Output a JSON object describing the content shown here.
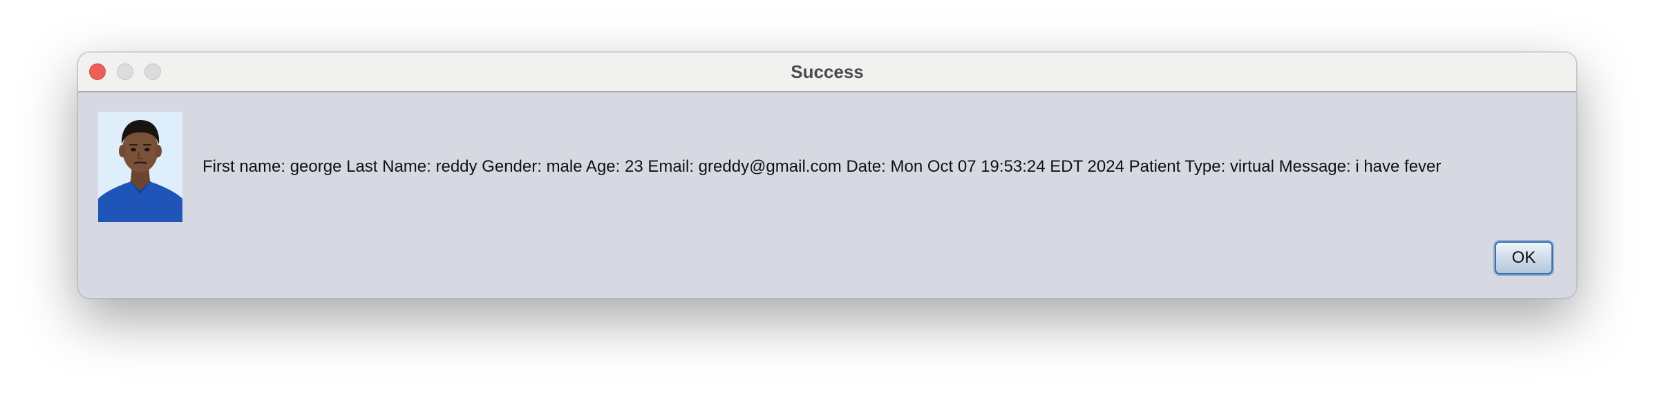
{
  "window": {
    "title": "Success"
  },
  "dialog": {
    "message": "First name: george Last Name: reddy Gender: male Age: 23 Email: greddy@gmail.com Date: Mon Oct 07 19:53:24 EDT 2024 Patient Type: virtual Message: i have fever",
    "ok_label": "OK",
    "avatar_icon": "patient-photo"
  },
  "colors": {
    "close_button": "#ee5f57",
    "titlebar": "#f1f1f0",
    "content_background": "#d6d9e1",
    "ok_border": "#3f6fa6"
  }
}
